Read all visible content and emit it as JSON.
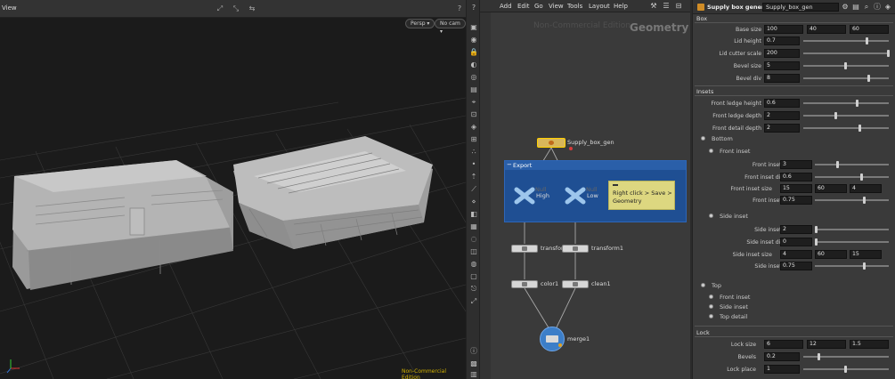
{
  "viewport": {
    "title": "View",
    "persp_label": "Persp ▾",
    "cam_label": "No cam ▾",
    "edition_label": "Non-Commercial Edition"
  },
  "network": {
    "menu": [
      "Add",
      "Edit",
      "Go",
      "View",
      "Tools",
      "Layout",
      "Help"
    ],
    "watermark_edition": "Non-Commercial Edition",
    "watermark_context": "Geometry",
    "netbox_title": "Export",
    "note_text": "Right click > Save > Geometry",
    "nodes": {
      "supply_box_gen": "Supply_box_gen",
      "high": "High",
      "low": "Low",
      "high_type": "Null",
      "low_type": "Null",
      "transform": "transform",
      "transform1": "transform1",
      "color1": "color1",
      "clean1": "clean1",
      "merge1": "merge1"
    }
  },
  "parameters": {
    "type_label": "Supply box generator",
    "node_name": "Supply_box_gen",
    "sections": {
      "box": "Box",
      "insets": "Insets",
      "lock": "Lock"
    },
    "box": {
      "base_size_label": "Base size",
      "base_size": [
        "100",
        "40",
        "60"
      ],
      "lid_height_label": "Lid height",
      "lid_height": "0.7",
      "lid_cutter_scale_label": "Lid cutter scale",
      "lid_cutter_scale": "200",
      "bevel_size_label": "Bevel size",
      "bevel_size": "5",
      "bevel_div_label": "Bevel div",
      "bevel_div": "8"
    },
    "insets": {
      "front_ledge_height_label": "Front ledge height",
      "front_ledge_height": "0.6",
      "front_ledge_depth_label": "Front ledge depth",
      "front_ledge_depth": "2",
      "front_detail_depth_label": "Front detail depth",
      "front_detail_depth": "2",
      "bottom_label": "Bottom",
      "front_inset_label": "Front inset",
      "front_inset_count_label": "Front inset count",
      "front_inset_count": "3",
      "front_inset_distance_label": "Front inset distance",
      "front_inset_distance": "0.6",
      "front_inset_size_label": "Front inset size",
      "front_inset_size": [
        "15",
        "60",
        "4"
      ],
      "front_inset_angle_label": "Front inset angle",
      "front_inset_angle": "0.75",
      "side_inset_label": "Side inset",
      "side_inset_count_label": "Side inset count",
      "side_inset_count": "2",
      "side_inset_distance_label": "Side inset distance",
      "side_inset_distance": "0",
      "side_inset_size_label": "Side inset size",
      "side_inset_size": [
        "4",
        "60",
        "15"
      ],
      "side_inset_angle_label": "Side inset angle",
      "side_inset_angle": "0.75",
      "top_label": "Top",
      "top_items": [
        "Front inset",
        "Side inset",
        "Top detail"
      ]
    },
    "lock": {
      "lock_size_label": "Lock size",
      "lock_size": [
        "6",
        "12",
        "1.5"
      ],
      "bevels_label": "Bevels",
      "bevels": "0.2",
      "lock_place_label": "Lock place",
      "lock_place": "1"
    }
  }
}
